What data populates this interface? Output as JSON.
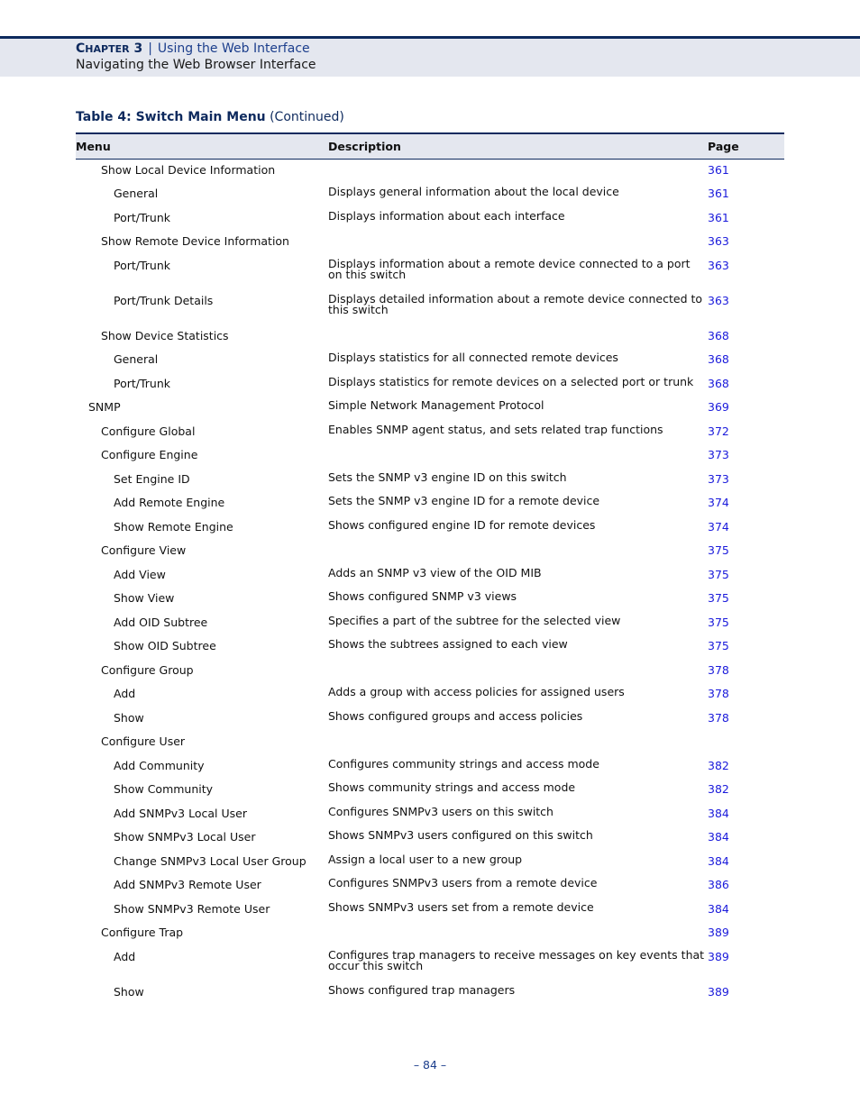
{
  "header": {
    "chapter_prefix": "C",
    "chapter_smallcaps": "HAPTER",
    "chapter_number": "3",
    "separator": "|",
    "chapter_title": "Using the Web Interface",
    "section_title": "Navigating the Web Browser Interface"
  },
  "table": {
    "caption_bold": "Table 4: Switch Main Menu",
    "caption_suffix": "(Continued)",
    "columns": [
      "Menu",
      "Description",
      "Page"
    ],
    "rows": [
      {
        "menu": "Show Local Device Information",
        "level": 2,
        "description": "",
        "page": "361"
      },
      {
        "menu": "General",
        "level": 3,
        "description": "Displays general information about the local device",
        "page": "361"
      },
      {
        "menu": "Port/Trunk",
        "level": 3,
        "description": "Displays information about each interface",
        "page": "361"
      },
      {
        "menu": "Show Remote Device Information",
        "level": 2,
        "description": "",
        "page": "363"
      },
      {
        "menu": "Port/Trunk",
        "level": 3,
        "description": "Displays information about a remote device connected to a port on this switch",
        "page": "363"
      },
      {
        "menu": "Port/Trunk Details",
        "level": 3,
        "description": "Displays detailed information about a remote device connected to this switch",
        "page": "363"
      },
      {
        "menu": "Show Device Statistics",
        "level": 2,
        "description": "",
        "page": "368"
      },
      {
        "menu": "General",
        "level": 3,
        "description": "Displays statistics for all connected remote devices",
        "page": "368"
      },
      {
        "menu": "Port/Trunk",
        "level": 3,
        "description": "Displays statistics for remote devices on a selected port or trunk",
        "page": "368"
      },
      {
        "menu": "SNMP",
        "level": 1,
        "description": "Simple Network Management Protocol",
        "page": "369"
      },
      {
        "menu": "Configure Global",
        "level": 2,
        "description": "Enables SNMP agent status, and sets related trap functions",
        "page": "372"
      },
      {
        "menu": "Configure Engine",
        "level": 2,
        "description": "",
        "page": "373"
      },
      {
        "menu": "Set Engine ID",
        "level": 3,
        "description": "Sets the SNMP v3 engine ID on this switch",
        "page": "373"
      },
      {
        "menu": "Add Remote Engine",
        "level": 3,
        "description": "Sets the SNMP v3 engine ID for a remote device",
        "page": "374"
      },
      {
        "menu": "Show Remote Engine",
        "level": 3,
        "description": "Shows configured engine ID for remote devices",
        "page": "374"
      },
      {
        "menu": "Configure View",
        "level": 2,
        "description": "",
        "page": "375"
      },
      {
        "menu": "Add View",
        "level": 3,
        "description": "Adds an SNMP v3 view of the OID MIB",
        "page": "375"
      },
      {
        "menu": "Show View",
        "level": 3,
        "description": "Shows configured SNMP v3 views",
        "page": "375"
      },
      {
        "menu": "Add OID Subtree",
        "level": 3,
        "description": "Specifies a part of the subtree for the selected view",
        "page": "375"
      },
      {
        "menu": "Show OID Subtree",
        "level": 3,
        "description": "Shows the subtrees assigned to each view",
        "page": "375"
      },
      {
        "menu": "Configure Group",
        "level": 2,
        "description": "",
        "page": "378"
      },
      {
        "menu": "Add",
        "level": 3,
        "description": "Adds a group with access policies for assigned users",
        "page": "378"
      },
      {
        "menu": "Show",
        "level": 3,
        "description": "Shows configured groups and access policies",
        "page": "378"
      },
      {
        "menu": "Configure User",
        "level": 2,
        "description": "",
        "page": ""
      },
      {
        "menu": "Add Community",
        "level": 3,
        "description": "Configures community strings and access mode",
        "page": "382"
      },
      {
        "menu": "Show Community",
        "level": 3,
        "description": "Shows community strings and access mode",
        "page": "382"
      },
      {
        "menu": "Add SNMPv3 Local User",
        "level": 3,
        "description": "Configures SNMPv3 users on this switch",
        "page": "384"
      },
      {
        "menu": "Show SNMPv3 Local User",
        "level": 3,
        "description": "Shows SNMPv3 users configured on this switch",
        "page": "384"
      },
      {
        "menu": "Change SNMPv3 Local User Group",
        "level": 3,
        "description": "Assign a local user to a new group",
        "page": "384"
      },
      {
        "menu": "Add SNMPv3 Remote User",
        "level": 3,
        "description": "Configures SNMPv3 users from a remote device",
        "page": "386"
      },
      {
        "menu": "Show SNMPv3 Remote User",
        "level": 3,
        "description": "Shows SNMPv3 users set from a remote device",
        "page": "384"
      },
      {
        "menu": "Configure Trap",
        "level": 2,
        "description": "",
        "page": "389"
      },
      {
        "menu": "Add",
        "level": 3,
        "description": "Configures trap managers to receive messages on key events that occur this switch",
        "page": "389"
      },
      {
        "menu": "Show",
        "level": 3,
        "description": "Shows configured trap managers",
        "page": "389"
      }
    ]
  },
  "footer": {
    "page_number": "–  84  –"
  },
  "colors": {
    "accent_navy": "#0e2a5e",
    "header_band": "#e4e7ef",
    "link_blue": "#1a1adb"
  }
}
